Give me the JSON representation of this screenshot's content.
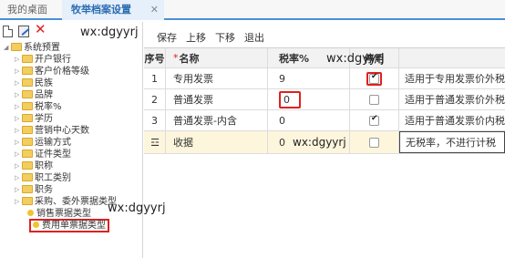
{
  "tabs": [
    {
      "label": "我的桌面",
      "active": false
    },
    {
      "label": "牧举档案设置",
      "active": true
    }
  ],
  "tab_close_icon": "close-icon",
  "watermark": "wx:dgyyrj",
  "left_toolbar": {
    "icons": [
      "new-document-icon",
      "edit-icon",
      "delete-icon"
    ]
  },
  "tree": {
    "root": "系统预置",
    "children": [
      "开户银行",
      "客户价格等级",
      "民族",
      "品牌",
      "税率%",
      "学历",
      "营销中心天数",
      "运输方式",
      "证件类型",
      "职称",
      "职工类别",
      "职务",
      "采购、委外票据类型"
    ],
    "leaves": [
      "销售票据类型",
      "费用单票据类型"
    ]
  },
  "toolbar": {
    "save": "保存",
    "up": "上移",
    "down": "下移",
    "exit": "退出"
  },
  "table": {
    "headers": {
      "seq": "序号",
      "required_mark": "*",
      "name": "名称",
      "rate": "税率%",
      "disabled": "停用"
    },
    "rows": [
      {
        "seq": "1",
        "name": "专用发票",
        "rate": "9",
        "disabled": true,
        "desc": "适用于专用发票价外税票"
      },
      {
        "seq": "2",
        "name": "普通发票",
        "rate": "0",
        "disabled": false,
        "desc": "适用于普通发票价外税票"
      },
      {
        "seq": "3",
        "name": "普通发票-内含",
        "rate": "0",
        "disabled": true,
        "desc": "适用于普通发票价内税票"
      },
      {
        "seq": "",
        "name": "收据",
        "rate": "0",
        "disabled": false,
        "desc": "无税率，不进行计税"
      }
    ]
  }
}
